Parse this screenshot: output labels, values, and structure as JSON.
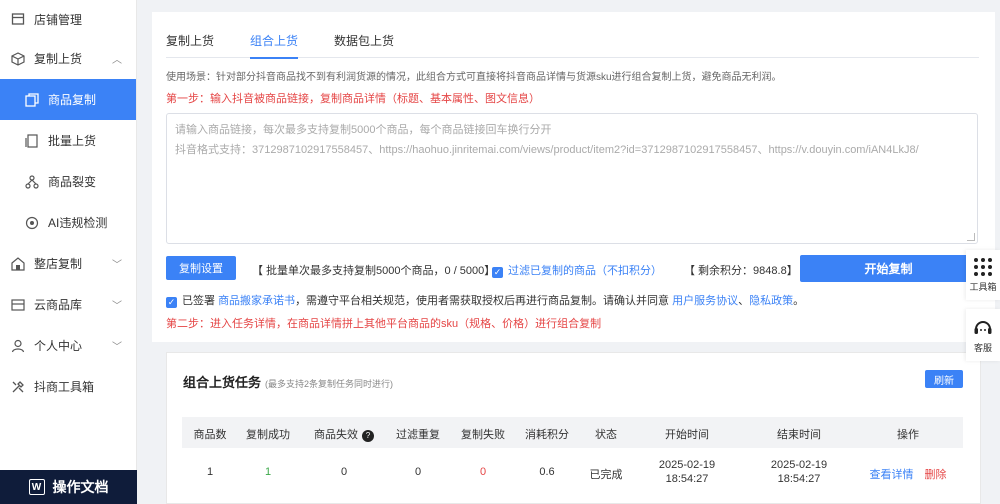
{
  "sidebar": {
    "items": [
      {
        "label": "店铺管理",
        "icon": "store-icon"
      },
      {
        "label": "复制上货",
        "icon": "box-icon"
      },
      {
        "label": "商品复制",
        "icon": "copy-icon"
      },
      {
        "label": "批量上货",
        "icon": "batch-icon"
      },
      {
        "label": "商品裂变",
        "icon": "split-icon"
      },
      {
        "label": "AI违规检测",
        "icon": "ai-icon"
      },
      {
        "label": "整店复制",
        "icon": "shop-icon"
      },
      {
        "label": "云商品库",
        "icon": "cloud-icon"
      },
      {
        "label": "个人中心",
        "icon": "user-icon"
      },
      {
        "label": "抖商工具箱",
        "icon": "tools-icon"
      }
    ],
    "docs_label": "操作文档"
  },
  "tabs": [
    "复制上货",
    "组合上货",
    "数据包上货"
  ],
  "usage_text": "使用场景：针对部分抖音商品找不到有利润货源的情况，此组合方式可直接将抖音商品详情与货源sku进行组合复制上货，避免商品无利润。",
  "step1": "第一步：输入抖音被商品链接，复制商品详情（标题、基本属性、图文信息）",
  "input": {
    "placeholder_line1": "请输入商品链接，每次最多支持复制5000个商品，每个商品链接回车换行分开",
    "placeholder_line2": "抖音格式支持：3712987102917558457、https://haohuo.jinritemai.com/views/product/item2?id=3712987102917558457、https://v.douyin.com/iAN4LkJ8/"
  },
  "controls": {
    "copy_settings": "复制设置",
    "batch_note": "【 批量单次最多支持复制5000个商品，0 / 5000】",
    "filter_label": "过滤已复制的商品（不扣积分）",
    "points": "【 剩余积分：9848.8】",
    "start_button": "开始复制"
  },
  "agreement": {
    "prefix": "已签署",
    "book_link": "商品搬家承诺书",
    "middle": "，需遵守平台相关规范，使用者需获取授权后再进行商品复制。请确认并同意",
    "service_link": "用户服务协议",
    "sep": "、",
    "privacy_link": "隐私政策",
    "end": "。"
  },
  "step2": "第二步：进入任务详情，在商品详情拼上其他平台商品的sku（规格、价格）进行组合复制",
  "task": {
    "title": "组合上货任务",
    "subtitle": "(最多支持2条复制任务同时进行)",
    "refresh": "刷新",
    "headers": [
      "商品数",
      "复制成功",
      "商品失效",
      "过滤重复",
      "复制失败",
      "消耗积分",
      "状态",
      "开始时间",
      "结束时间",
      "操作"
    ],
    "rows": [
      {
        "count": "1",
        "success": "1",
        "invalid": "0",
        "dup": "0",
        "fail": "0",
        "points": "0.6",
        "status": "已完成",
        "start_date": "2025-02-19",
        "start_time": "18:54:27",
        "end_date": "2025-02-19",
        "end_time": "18:54:27",
        "view": "查看详情",
        "delete": "删除"
      }
    ]
  },
  "float": {
    "tools": "工具箱",
    "service": "客服"
  },
  "colors": {
    "primary": "#3b82f6",
    "danger": "#e54545",
    "success": "#3ca94a",
    "docs_bg": "#0f1c3a"
  }
}
